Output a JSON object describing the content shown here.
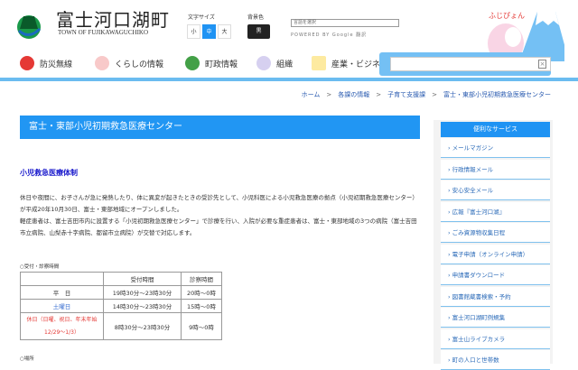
{
  "header": {
    "title": "富士河口湖町",
    "subtitle": "TOWN OF FUJIKAWAGUCHIKO",
    "font_size_label": "文字サイズ",
    "font_sizes": [
      "小",
      "中",
      "大"
    ],
    "bg_color_label": "背景色",
    "bg_option": "黒",
    "lang_select": "言語を選択",
    "powered_by": "POWERED BY Google 翻訳",
    "mascot_text": "ふじぴょん"
  },
  "nav": [
    {
      "label": "防災無線",
      "color": "#e53935"
    },
    {
      "label": "くらしの情報",
      "color": "#e57373"
    },
    {
      "label": "町政情報",
      "color": "#43a047"
    },
    {
      "label": "組織",
      "color": "#7e57c2"
    },
    {
      "label": "産業・ビジネ",
      "color": "#fbc02d"
    }
  ],
  "breadcrumb": [
    "ホーム",
    "各課の情報",
    "子育て支援課",
    "富士・東部小児初期救急医療センター"
  ],
  "page_title": "富士・東部小児初期救急医療センター",
  "section_heading": "小児救急医療体制",
  "paragraphs": [
    "休日や夜間に、お子さんが急に発熱したり、体に異変が起きたときの受診先として、小児科医による小児救急医療の拠点（小児初期救急医療センター）が平成20年10月30日、富士・東部地域にオープンしました。",
    "軽症患者は、富士吉田市内に設置する「小児初期救急医療センター」で診療を行い、入院が必要な重症患者は、富士・東部地域の3つの病院（富士吉田市立病院、山梨赤十字病院、都留市立病院）が交替で対応します。"
  ],
  "hours_caption": "○受付・診察時間",
  "table": {
    "headers": [
      "",
      "受付時間",
      "診察時間"
    ],
    "rows": [
      [
        "平　日",
        "19時30分～23時30分",
        "20時～0時"
      ],
      [
        "土曜日",
        "14時30分～23時30分",
        "15時～0時"
      ],
      [
        "休日（日曜、祝日、年末年始12/29～1/3）",
        "8時30分～23時30分",
        "9時～0時"
      ]
    ]
  },
  "place_caption": "○場所",
  "sidebar": {
    "heading": "便利なサービス",
    "items": [
      "メールマガジン",
      "行政情報メール",
      "安心安全メール",
      "広報『富士河口湖』",
      "ごみ資源物収集日程",
      "電子申請（オンライン申請）",
      "申請書ダウンロード",
      "図書館蔵書検索・予約",
      "富士河口湖町例規集",
      "富士山ライブカメラ",
      "町の人口と世帯数"
    ]
  }
}
